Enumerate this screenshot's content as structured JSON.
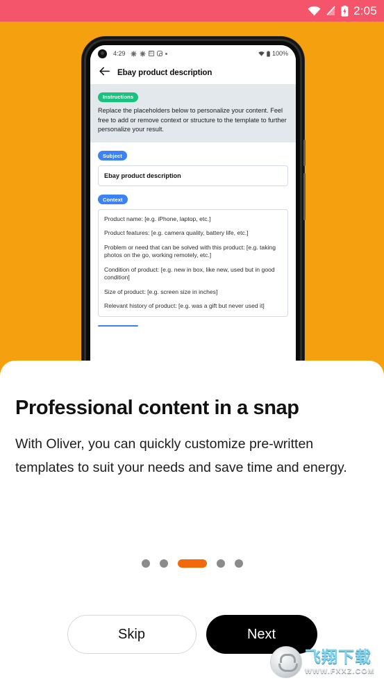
{
  "device_status_bar": {
    "time": "2:05",
    "icons": [
      "wifi-icon",
      "signal-off-icon",
      "battery-charging-icon"
    ],
    "background_color": "#F4556B"
  },
  "background_color": "#F5A00E",
  "phone_preview": {
    "status_bar": {
      "time": "4:29",
      "battery_percent": "100%",
      "left_icons": [
        "asterisk-icon",
        "asterisk-icon",
        "calendar-icon",
        "instagram-icon",
        "dot-icon"
      ],
      "calendar_day": "31",
      "right_icons": [
        "wifi-icon",
        "battery-icon"
      ]
    },
    "app_bar": {
      "back_icon": "back-arrow-icon",
      "title": "Ebay product description"
    },
    "instructions": {
      "chip_label": "Instructions",
      "chip_color": "#19c37d",
      "text": "Replace the placeholders below to personalize your content. Feel free to add or remove context or structure to the template to further personalize your result."
    },
    "subject": {
      "chip_label": "Subject",
      "chip_color": "#3b82f6",
      "value": "Ebay product description"
    },
    "context": {
      "chip_label": "Context",
      "chip_color": "#3b82f6",
      "lines": [
        "Product name: [e.g. iPhone, laptop, etc.]",
        "Product features: [e.g. camera quality, battery life, etc.]",
        "Problem or need that can be solved with this product: [e.g. taking photos on the go, working remotely, etc.]",
        "Condition of product: [e.g. new in box, like new, used but in good condition]",
        "Size of product: [e.g. screen size in inches]",
        "Relevant history of product: [e.g. was a gift but never used it]"
      ]
    }
  },
  "sheet": {
    "headline": "Professional content in a snap",
    "body": "With Oliver, you can quickly customize pre-written templates to suit your needs and save time and energy.",
    "pagination": {
      "total": 5,
      "active_index": 2,
      "active_color": "#F2690C",
      "inactive_color": "#8b8b8b"
    },
    "buttons": {
      "skip_label": "Skip",
      "next_label": "Next",
      "next_background": "#000000"
    }
  },
  "watermark": {
    "chinese_text": "飞翔下载",
    "url": "WWW.FXXZ.COM",
    "accent_color": "#7fd4ef"
  }
}
